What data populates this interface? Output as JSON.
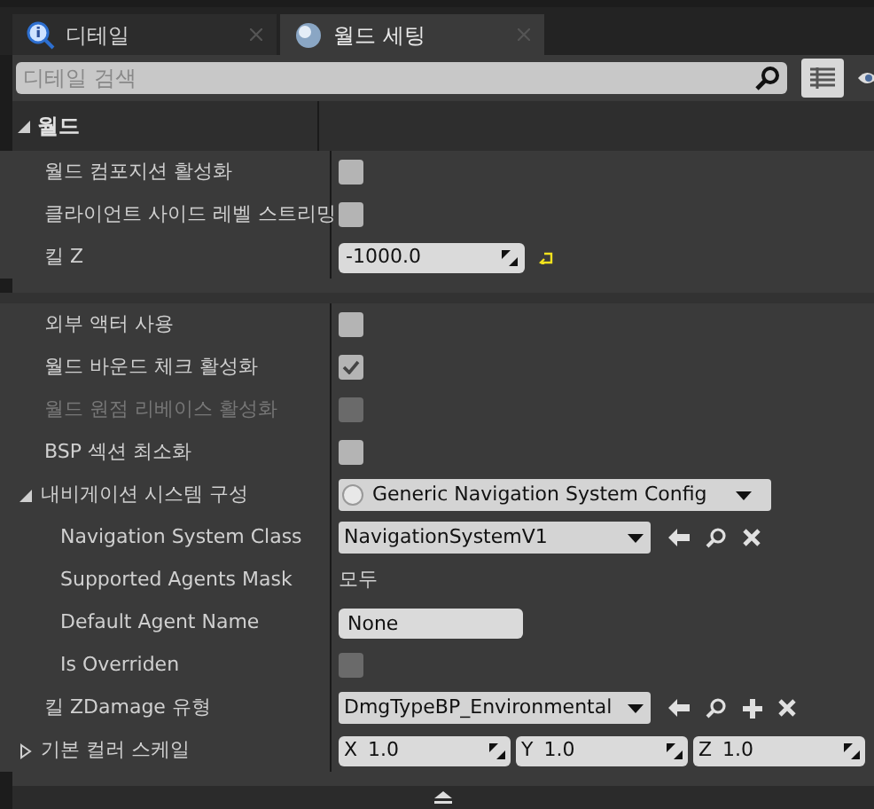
{
  "tabs": [
    {
      "label": "디테일",
      "selected": false
    },
    {
      "label": "월드 세팅",
      "selected": true
    }
  ],
  "search": {
    "placeholder": "디테일 검색"
  },
  "section": {
    "title": "월드",
    "expanded": true,
    "groups": [
      [
        {
          "kind": "checkbox",
          "label": "월드 컴포지션 활성화",
          "checked": false
        },
        {
          "kind": "checkbox",
          "label": "클라이언트 사이드 레벨 스트리밍",
          "checked": false
        },
        {
          "kind": "number",
          "label": "킬 Z",
          "value": "-1000.0",
          "resettable": true
        }
      ],
      [
        {
          "kind": "checkbox",
          "label": "외부 액터 사용",
          "checked": false
        },
        {
          "kind": "checkbox",
          "label": "월드 바운드 체크 활성화",
          "checked": true
        },
        {
          "kind": "checkbox",
          "label": "월드 원점 리베이스 활성화",
          "checked": false,
          "disabled": true,
          "dimmed": true
        },
        {
          "kind": "checkbox",
          "label": "BSP 섹션 최소화",
          "checked": false
        },
        {
          "kind": "dropdown",
          "label": "내비게이션 시스템 구성",
          "value": "Generic Navigation System Config",
          "expanded": true,
          "children": [
            {
              "kind": "class",
              "label": "Navigation System Class",
              "value": "NavigationSystemV1",
              "actions": [
                {
                  "kind": "use"
                },
                {
                  "kind": "browse"
                },
                {
                  "kind": "clear"
                }
              ]
            },
            {
              "kind": "text",
              "label": "Supported Agents Mask",
              "value": "모두"
            },
            {
              "kind": "input",
              "label": "Default Agent Name",
              "value": "None"
            },
            {
              "kind": "checkbox",
              "label": "Is Overriden",
              "checked": false,
              "disabled": true
            }
          ]
        },
        {
          "kind": "class",
          "label": "킬 ZDamage 유형",
          "value": "DmgTypeBP_Environmental",
          "actions": [
            {
              "kind": "use"
            },
            {
              "kind": "browse"
            },
            {
              "kind": "add"
            },
            {
              "kind": "clear"
            }
          ]
        },
        {
          "kind": "vector",
          "label": "기본 컬러 스케일",
          "expanded": false,
          "values": [
            {
              "axis": "X",
              "value": "1.0"
            },
            {
              "axis": "Y",
              "value": "1.0"
            },
            {
              "axis": "Z",
              "value": "1.0"
            }
          ]
        }
      ]
    ]
  }
}
